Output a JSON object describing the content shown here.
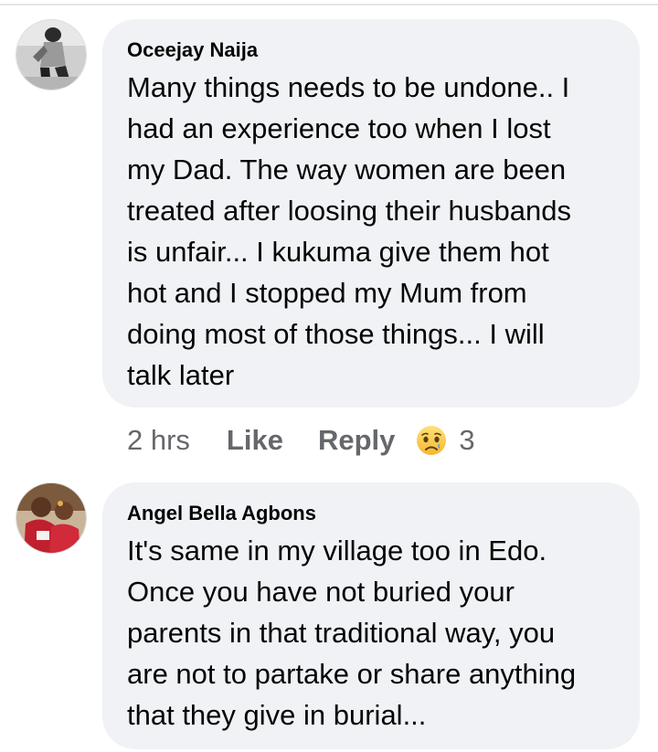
{
  "comments": [
    {
      "author": "Oceejay Naija",
      "avatar_icon": "profile-photo",
      "lines": [
        "Many things needs to be undone..  I",
        "had an experience too when I lost",
        "my Dad. The way women are been",
        "treated after loosing their husbands",
        "is unfair... I kukuma give them hot",
        "hot and I stopped my Mum from",
        "doing most of those things... I will",
        "talk later"
      ],
      "time": "2 hrs",
      "like_label": "Like",
      "reply_label": "Reply",
      "reaction_icon": "sad-reaction-icon",
      "reaction_count": "3"
    },
    {
      "author": "Angel Bella Agbons",
      "avatar_icon": "profile-photo",
      "lines": [
        "It's same in my village too in Edo.",
        "Once you have not buried your",
        "parents in that traditional way, you",
        "are not to partake or share anything",
        "that they give in burial..."
      ]
    }
  ],
  "colors": {
    "bubble": "#f0f2f5",
    "text": "#050505",
    "meta": "#65676b"
  }
}
